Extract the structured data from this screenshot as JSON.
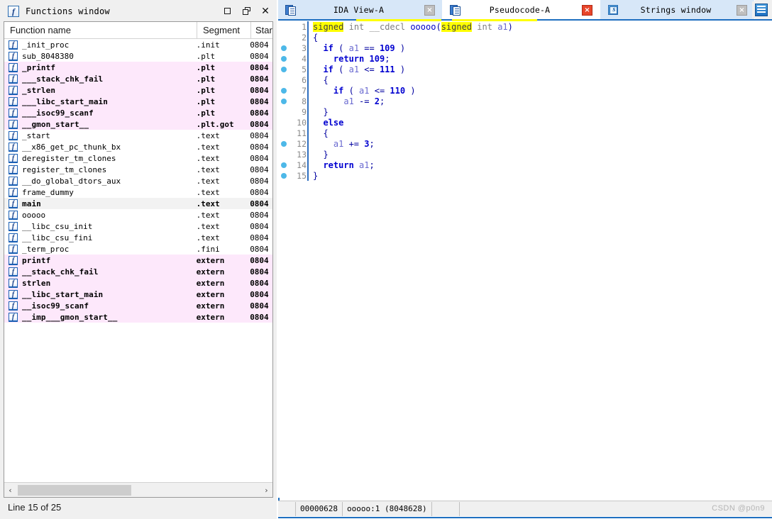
{
  "functions_window": {
    "title": "Functions window",
    "title_icon": "function-f-icon",
    "window_buttons": [
      {
        "name": "maximize",
        "glyph": "maximize-icon"
      },
      {
        "name": "restore",
        "glyph": "restore-icon"
      },
      {
        "name": "close",
        "glyph": "close-icon"
      }
    ],
    "columns": [
      "Function name",
      "Segment",
      "Star"
    ],
    "status": "Line 15 of 25",
    "rows": [
      {
        "name": "_init_proc",
        "segment": ".init",
        "start": "0804",
        "style": "normal"
      },
      {
        "name": "sub_8048380",
        "segment": ".plt",
        "start": "0804",
        "style": "normal"
      },
      {
        "name": "_printf",
        "segment": ".plt",
        "start": "0804",
        "style": "pink"
      },
      {
        "name": "___stack_chk_fail",
        "segment": ".plt",
        "start": "0804",
        "style": "pink"
      },
      {
        "name": "_strlen",
        "segment": ".plt",
        "start": "0804",
        "style": "pink"
      },
      {
        "name": "___libc_start_main",
        "segment": ".plt",
        "start": "0804",
        "style": "pink"
      },
      {
        "name": "___isoc99_scanf",
        "segment": ".plt",
        "start": "0804",
        "style": "pink"
      },
      {
        "name": "__gmon_start__",
        "segment": ".plt.got",
        "start": "0804",
        "style": "pink"
      },
      {
        "name": "_start",
        "segment": ".text",
        "start": "0804",
        "style": "normal"
      },
      {
        "name": "__x86_get_pc_thunk_bx",
        "segment": ".text",
        "start": "0804",
        "style": "normal"
      },
      {
        "name": "deregister_tm_clones",
        "segment": ".text",
        "start": "0804",
        "style": "normal"
      },
      {
        "name": "register_tm_clones",
        "segment": ".text",
        "start": "0804",
        "style": "normal"
      },
      {
        "name": "__do_global_dtors_aux",
        "segment": ".text",
        "start": "0804",
        "style": "normal"
      },
      {
        "name": "frame_dummy",
        "segment": ".text",
        "start": "0804",
        "style": "normal"
      },
      {
        "name": "main",
        "segment": ".text",
        "start": "0804",
        "style": "selected"
      },
      {
        "name": "ooooo",
        "segment": ".text",
        "start": "0804",
        "style": "normal"
      },
      {
        "name": "__libc_csu_init",
        "segment": ".text",
        "start": "0804",
        "style": "normal"
      },
      {
        "name": "__libc_csu_fini",
        "segment": ".text",
        "start": "0804",
        "style": "normal"
      },
      {
        "name": "_term_proc",
        "segment": ".fini",
        "start": "0804",
        "style": "normal"
      },
      {
        "name": "printf",
        "segment": "extern",
        "start": "0804",
        "style": "pink"
      },
      {
        "name": "__stack_chk_fail",
        "segment": "extern",
        "start": "0804",
        "style": "pink"
      },
      {
        "name": "strlen",
        "segment": "extern",
        "start": "0804",
        "style": "pink"
      },
      {
        "name": "__libc_start_main",
        "segment": "extern",
        "start": "0804",
        "style": "pink"
      },
      {
        "name": "__isoc99_scanf",
        "segment": "extern",
        "start": "0804",
        "style": "pink"
      },
      {
        "name": "__imp___gmon_start__",
        "segment": "extern",
        "start": "0804",
        "style": "pink"
      }
    ],
    "scrollbar": {
      "left_arrow": "‹",
      "right_arrow": "›"
    }
  },
  "right_panel": {
    "tabs": [
      {
        "label": "IDA View-A",
        "icon": "document-pages-icon",
        "active": false,
        "close": "×"
      },
      {
        "label": "Pseudocode-A",
        "icon": "document-pages-icon",
        "active": true,
        "close": "×"
      },
      {
        "label": "Strings window",
        "icon": "strings-s-icon",
        "active": false,
        "close": "×"
      }
    ],
    "extra_button_icon": "list-view-icon",
    "statusbar": {
      "offset": "00000628",
      "location": "ooooo:1  (8048628)"
    },
    "watermark": "CSDN @p0n9",
    "code_lines": [
      {
        "num": "1",
        "bp": false,
        "tokens": [
          {
            "t": "signed",
            "c": "tk-hl"
          },
          {
            "t": " ",
            "c": "tk-plain"
          },
          {
            "t": "int",
            "c": "tk-type"
          },
          {
            "t": " ",
            "c": "tk-plain"
          },
          {
            "t": "__cdecl",
            "c": "tk-type"
          },
          {
            "t": " ",
            "c": "tk-plain"
          },
          {
            "t": "ooooo",
            "c": "tk-fn"
          },
          {
            "t": "(",
            "c": "tk-punct"
          },
          {
            "t": "signed",
            "c": "tk-hl"
          },
          {
            "t": " ",
            "c": "tk-plain"
          },
          {
            "t": "int",
            "c": "tk-type"
          },
          {
            "t": " ",
            "c": "tk-plain"
          },
          {
            "t": "a1",
            "c": "tk-var"
          },
          {
            "t": ")",
            "c": "tk-punct"
          }
        ]
      },
      {
        "num": "2",
        "bp": false,
        "tokens": [
          {
            "t": "{",
            "c": "tk-punct"
          }
        ]
      },
      {
        "num": "3",
        "bp": true,
        "tokens": [
          {
            "t": "  ",
            "c": "tk-plain"
          },
          {
            "t": "if",
            "c": "tk-kw"
          },
          {
            "t": " ( ",
            "c": "tk-punct"
          },
          {
            "t": "a1",
            "c": "tk-var"
          },
          {
            "t": " == ",
            "c": "tk-punct"
          },
          {
            "t": "109",
            "c": "tk-num"
          },
          {
            "t": " )",
            "c": "tk-punct"
          }
        ]
      },
      {
        "num": "4",
        "bp": true,
        "tokens": [
          {
            "t": "    ",
            "c": "tk-plain"
          },
          {
            "t": "return",
            "c": "tk-kw"
          },
          {
            "t": " ",
            "c": "tk-plain"
          },
          {
            "t": "109",
            "c": "tk-num"
          },
          {
            "t": ";",
            "c": "tk-punct"
          }
        ]
      },
      {
        "num": "5",
        "bp": true,
        "tokens": [
          {
            "t": "  ",
            "c": "tk-plain"
          },
          {
            "t": "if",
            "c": "tk-kw"
          },
          {
            "t": " ( ",
            "c": "tk-punct"
          },
          {
            "t": "a1",
            "c": "tk-var"
          },
          {
            "t": " <= ",
            "c": "tk-punct"
          },
          {
            "t": "111",
            "c": "tk-num"
          },
          {
            "t": " )",
            "c": "tk-punct"
          }
        ]
      },
      {
        "num": "6",
        "bp": false,
        "tokens": [
          {
            "t": "  {",
            "c": "tk-punct"
          }
        ]
      },
      {
        "num": "7",
        "bp": true,
        "tokens": [
          {
            "t": "    ",
            "c": "tk-plain"
          },
          {
            "t": "if",
            "c": "tk-kw"
          },
          {
            "t": " ( ",
            "c": "tk-punct"
          },
          {
            "t": "a1",
            "c": "tk-var"
          },
          {
            "t": " <= ",
            "c": "tk-punct"
          },
          {
            "t": "110",
            "c": "tk-num"
          },
          {
            "t": " )",
            "c": "tk-punct"
          }
        ]
      },
      {
        "num": "8",
        "bp": true,
        "tokens": [
          {
            "t": "      ",
            "c": "tk-plain"
          },
          {
            "t": "a1",
            "c": "tk-var"
          },
          {
            "t": " -= ",
            "c": "tk-punct"
          },
          {
            "t": "2",
            "c": "tk-num"
          },
          {
            "t": ";",
            "c": "tk-punct"
          }
        ]
      },
      {
        "num": "9",
        "bp": false,
        "tokens": [
          {
            "t": "  }",
            "c": "tk-punct"
          }
        ]
      },
      {
        "num": "10",
        "bp": false,
        "tokens": [
          {
            "t": "  ",
            "c": "tk-plain"
          },
          {
            "t": "else",
            "c": "tk-kw"
          }
        ]
      },
      {
        "num": "11",
        "bp": false,
        "tokens": [
          {
            "t": "  {",
            "c": "tk-punct"
          }
        ]
      },
      {
        "num": "12",
        "bp": true,
        "tokens": [
          {
            "t": "    ",
            "c": "tk-plain"
          },
          {
            "t": "a1",
            "c": "tk-var"
          },
          {
            "t": " += ",
            "c": "tk-punct"
          },
          {
            "t": "3",
            "c": "tk-num"
          },
          {
            "t": ";",
            "c": "tk-punct"
          }
        ]
      },
      {
        "num": "13",
        "bp": false,
        "tokens": [
          {
            "t": "  }",
            "c": "tk-punct"
          }
        ]
      },
      {
        "num": "14",
        "bp": true,
        "tokens": [
          {
            "t": "  ",
            "c": "tk-plain"
          },
          {
            "t": "return",
            "c": "tk-kw"
          },
          {
            "t": " ",
            "c": "tk-plain"
          },
          {
            "t": "a1",
            "c": "tk-var"
          },
          {
            "t": ";",
            "c": "tk-punct"
          }
        ]
      },
      {
        "num": "15",
        "bp": true,
        "tokens": [
          {
            "t": "}",
            "c": "tk-punct"
          }
        ]
      }
    ]
  },
  "colors": {
    "accent_blue": "#1f6fc0",
    "pink_row": "#fde8fb",
    "selected_row": "#f2f2f2",
    "highlight_yellow": "#ffff00",
    "tab_inactive": "#d7e7f8",
    "close_active": "#e8452a"
  }
}
